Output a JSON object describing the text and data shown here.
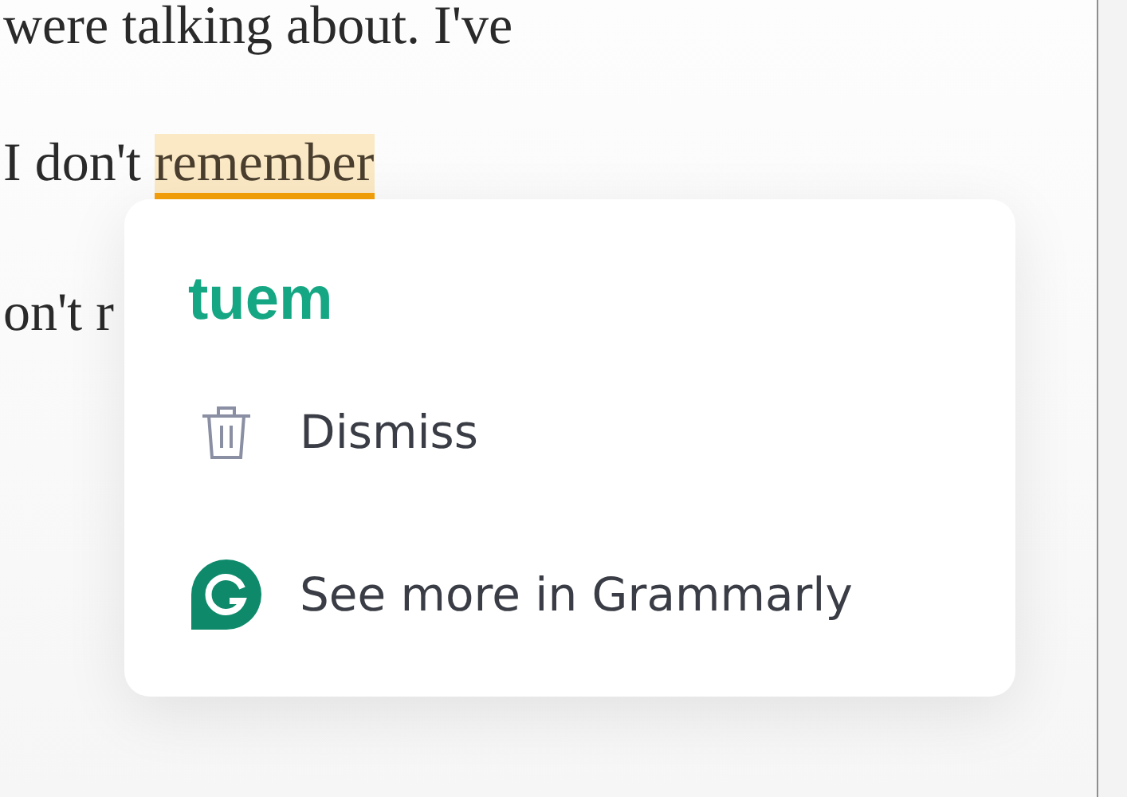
{
  "document": {
    "lines": [
      {
        "text": "were talking about. I've"
      },
      {
        "text": "I don't ",
        "flagged": "remember"
      },
      {
        "text": "on't r"
      }
    ]
  },
  "suggestion_card": {
    "replacement": "tuem",
    "actions": [
      {
        "kind": "dismiss",
        "label": "Dismiss"
      },
      {
        "kind": "grammarly",
        "label": "See more in Grammarly"
      }
    ]
  }
}
